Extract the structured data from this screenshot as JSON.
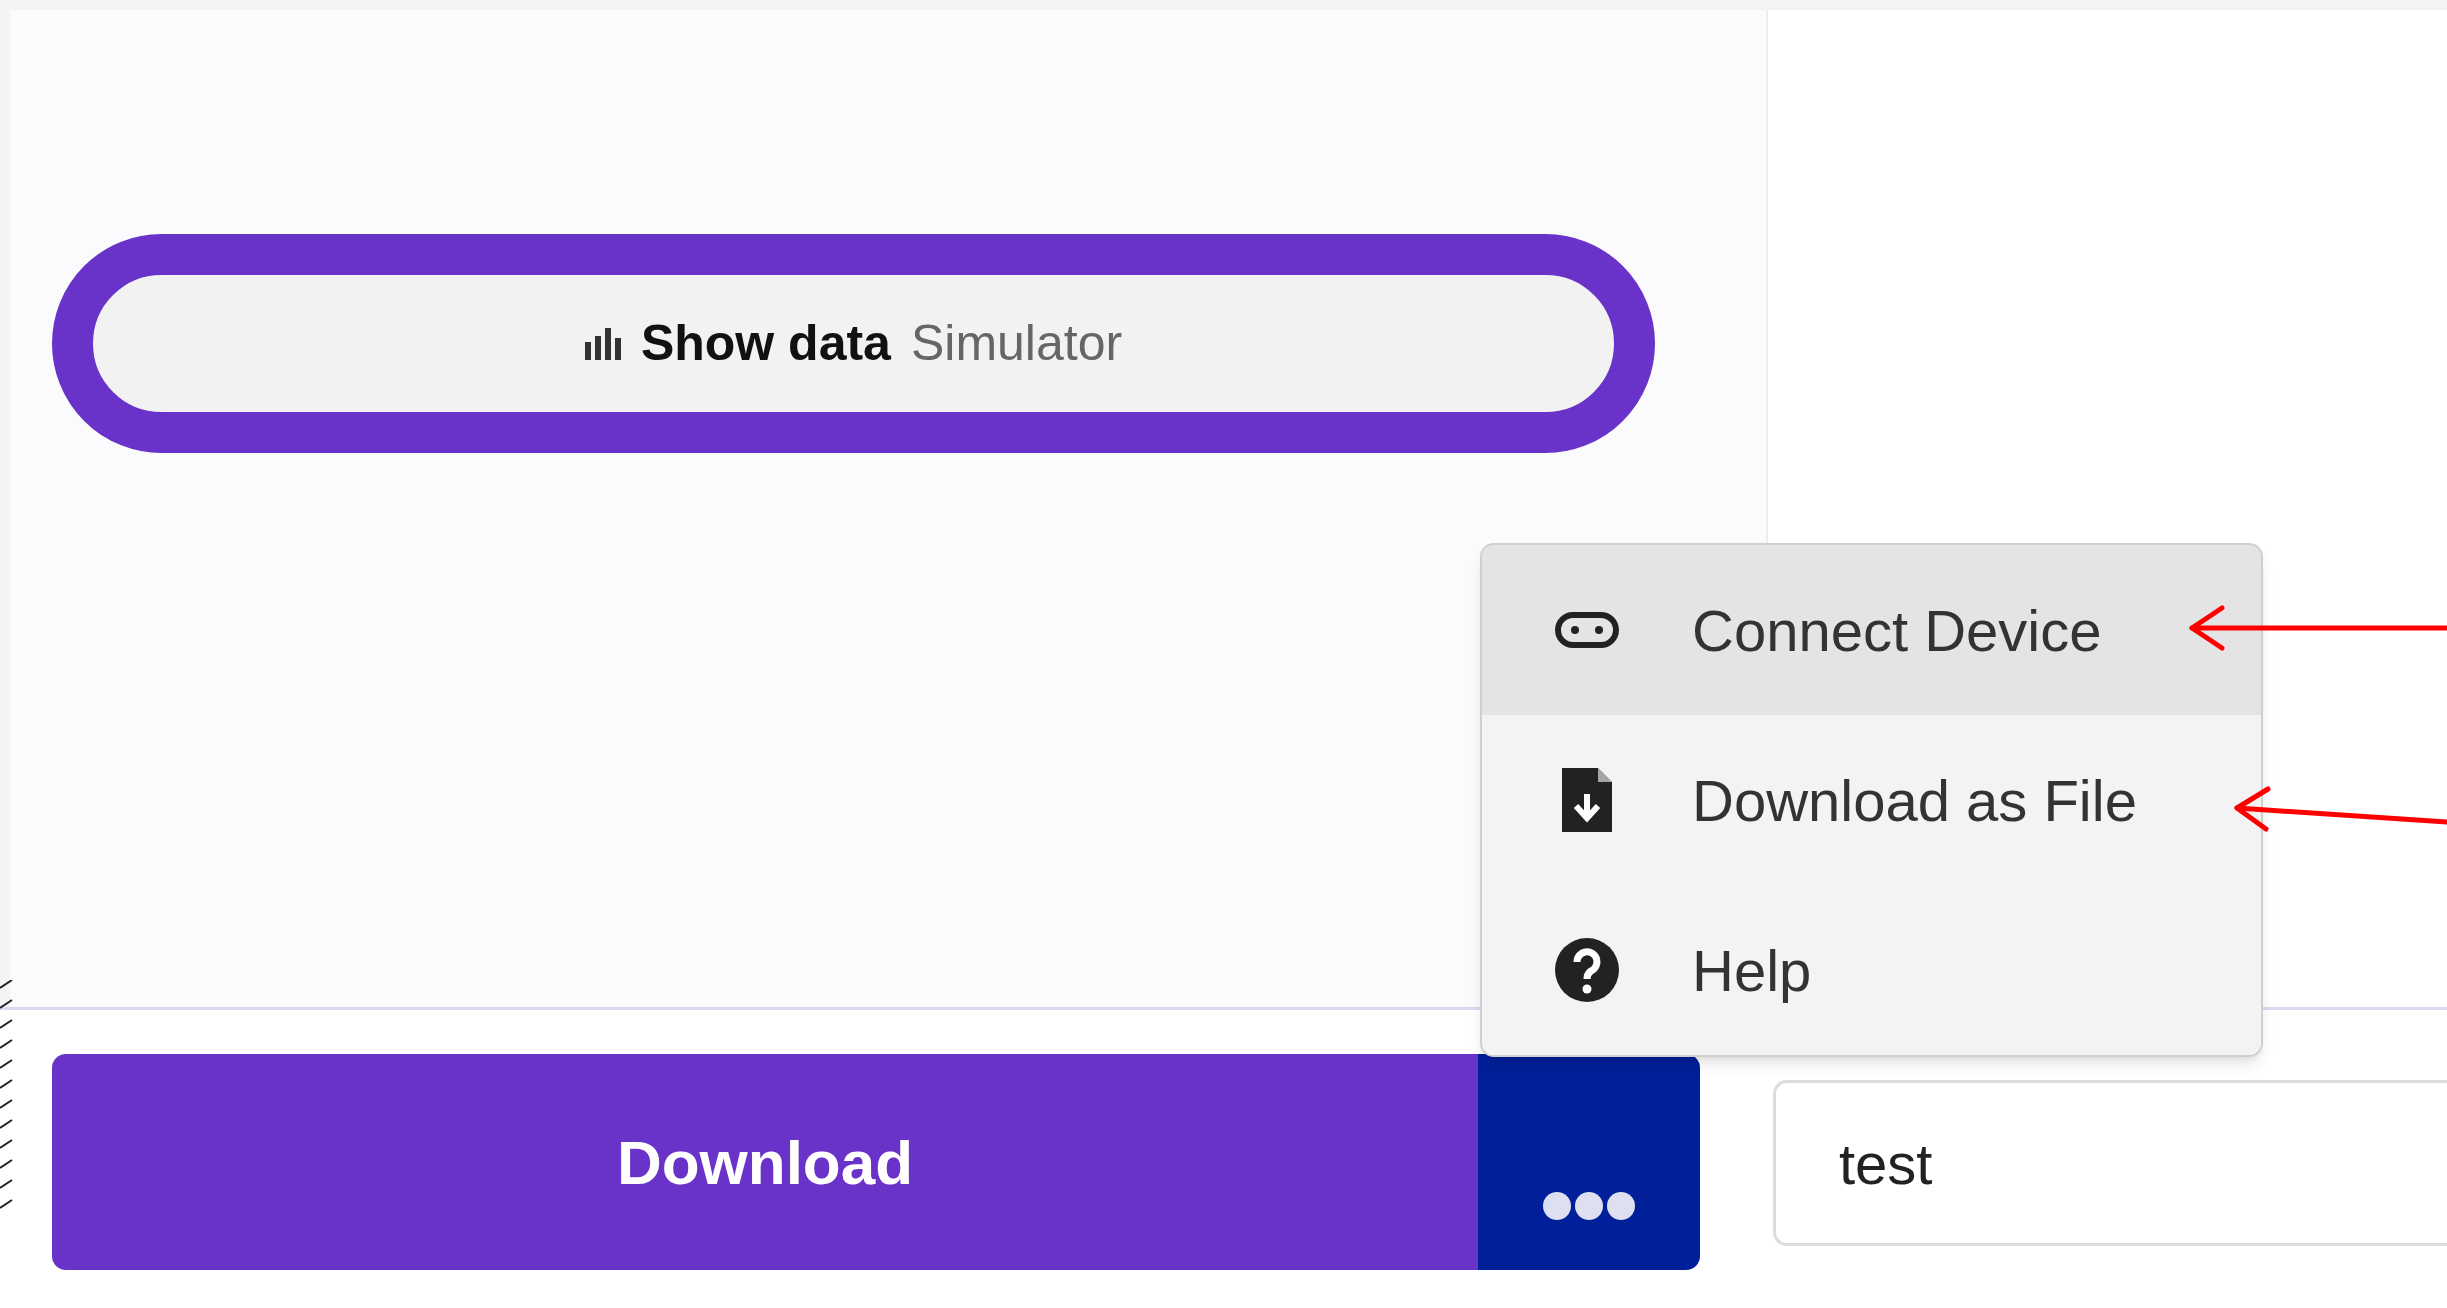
{
  "show_data_button": {
    "label": "Show data",
    "sublabel": "Simulator"
  },
  "menu": {
    "items": [
      {
        "kind": "device",
        "label": "Connect Device",
        "selected": true
      },
      {
        "kind": "file",
        "label": "Download as File",
        "selected": false
      },
      {
        "kind": "help",
        "label": "Help",
        "selected": false
      }
    ]
  },
  "download_button": {
    "label": "Download"
  },
  "project_name_field": {
    "value": "test"
  }
}
